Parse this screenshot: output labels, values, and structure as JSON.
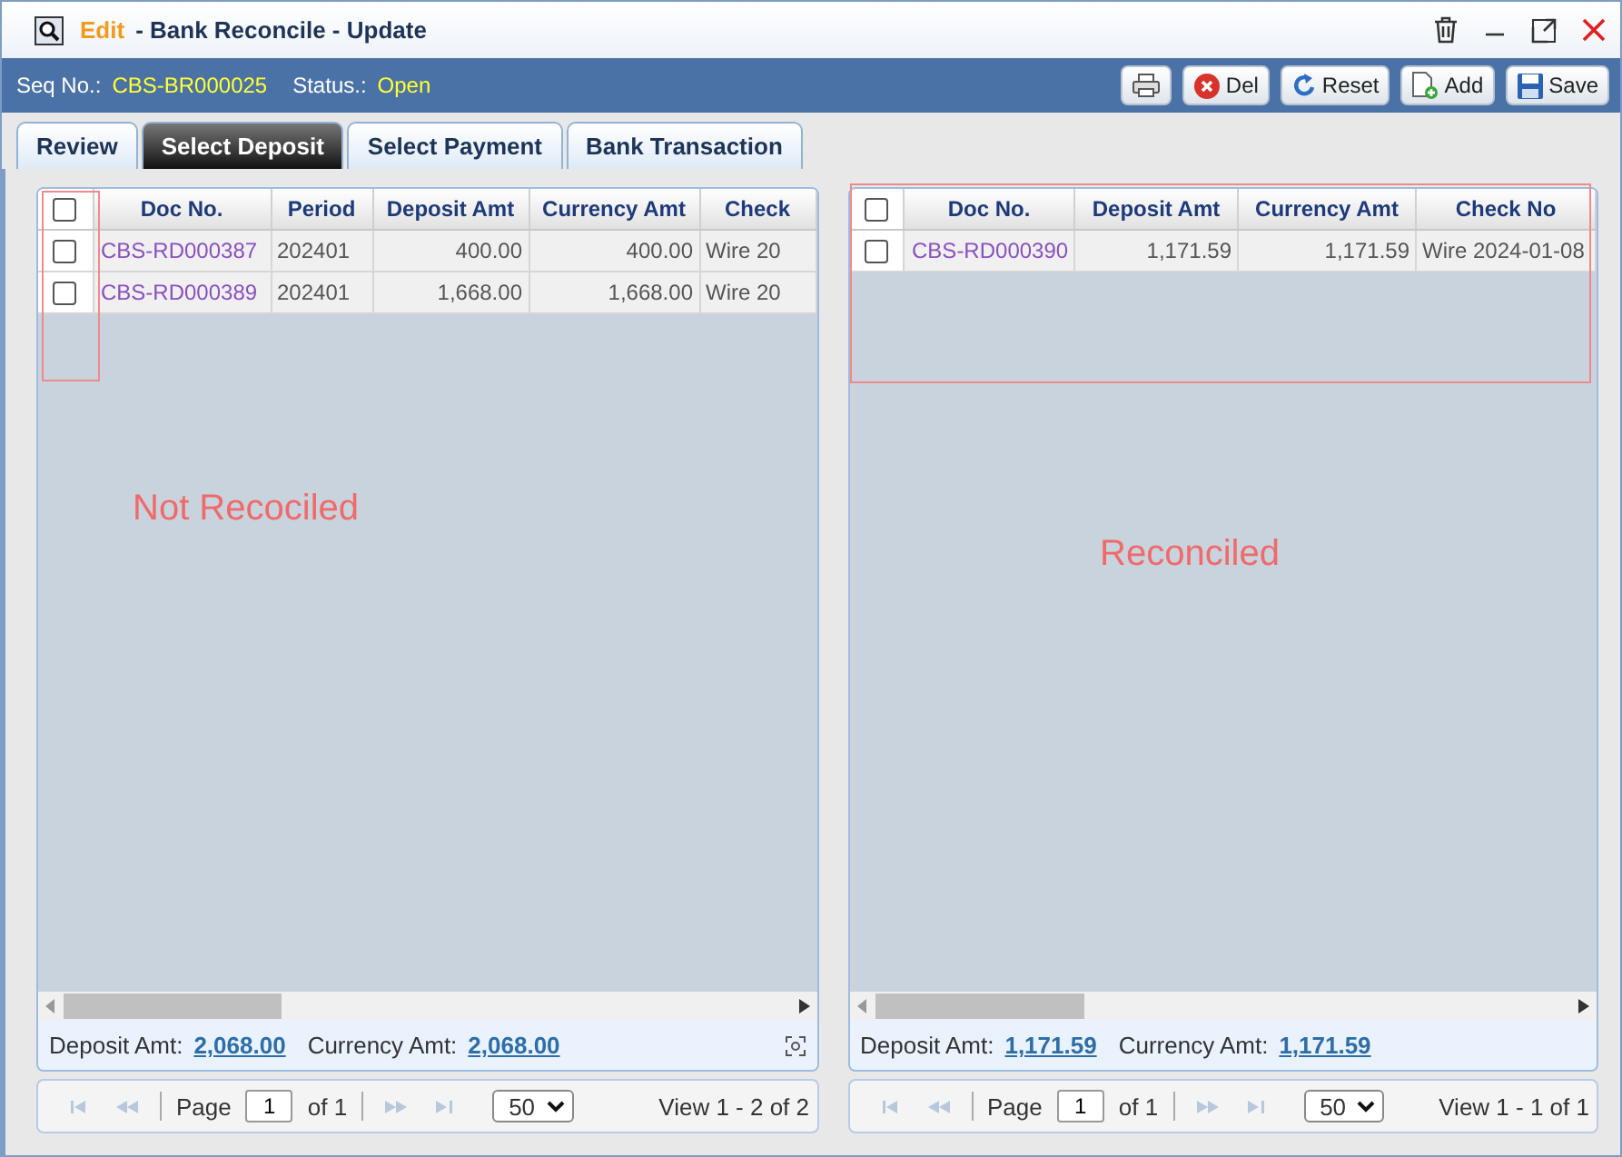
{
  "window": {
    "mode": "Edit",
    "title": "- Bank Reconcile - Update"
  },
  "info": {
    "seq_label": "Seq No.:",
    "seq_value": "CBS-BR000025",
    "status_label": "Status.:",
    "status_value": "Open"
  },
  "toolbar": [
    {
      "kind": "print"
    },
    {
      "kind": "delete",
      "label": "Del"
    },
    {
      "kind": "reset",
      "label": "Reset"
    },
    {
      "kind": "add",
      "label": "Add"
    },
    {
      "kind": "save",
      "label": "Save"
    }
  ],
  "tabs": [
    {
      "label": "Review",
      "selected": false
    },
    {
      "label": "Select Deposit",
      "selected": true
    },
    {
      "label": "Select Payment",
      "selected": false
    },
    {
      "label": "Bank Transaction",
      "selected": false
    }
  ],
  "grids": [
    {
      "header_checked": false,
      "expand_icon": true,
      "columns": [
        {
          "label": "Doc No.",
          "kind": "link"
        },
        {
          "label": "Period",
          "kind": "text"
        },
        {
          "label": "Deposit Amt",
          "kind": "amount"
        },
        {
          "label": "Currency Amt",
          "kind": "amount"
        },
        {
          "label": "Check",
          "kind": "text"
        }
      ],
      "rows": [
        {
          "checked": false,
          "cells": [
            "CBS-RD000387",
            "202401",
            "400.00",
            "400.00",
            "Wire 20"
          ]
        },
        {
          "checked": false,
          "cells": [
            "CBS-RD000389",
            "202401",
            "1,668.00",
            "1,668.00",
            "Wire 20"
          ]
        }
      ],
      "totals": [
        {
          "label": "Deposit Amt:",
          "value": "2,068.00"
        },
        {
          "label": "Currency Amt:",
          "value": "2,068.00"
        }
      ],
      "pager": {
        "page_label": "Page",
        "page": "1",
        "of": "of 1",
        "per_page": "50",
        "view": "View 1 - 2 of 2"
      },
      "annotation": "Not Recociled"
    },
    {
      "header_checked": false,
      "expand_icon": false,
      "columns": [
        {
          "label": "Doc No.",
          "kind": "link"
        },
        {
          "label": "Deposit Amt",
          "kind": "amount"
        },
        {
          "label": "Currency Amt",
          "kind": "amount"
        },
        {
          "label": "Check No",
          "kind": "text"
        }
      ],
      "rows": [
        {
          "checked": false,
          "cells": [
            "CBS-RD000390",
            "1,171.59",
            "1,171.59",
            "Wire 2024-01-08"
          ]
        }
      ],
      "totals": [
        {
          "label": "Deposit Amt:",
          "value": "1,171.59"
        },
        {
          "label": "Currency Amt:",
          "value": "1,171.59"
        }
      ],
      "pager": {
        "page_label": "Page",
        "page": "1",
        "of": "of 1",
        "per_page": "50",
        "view": "View 1 - 1 of 1"
      },
      "annotation": "Reconciled"
    }
  ]
}
